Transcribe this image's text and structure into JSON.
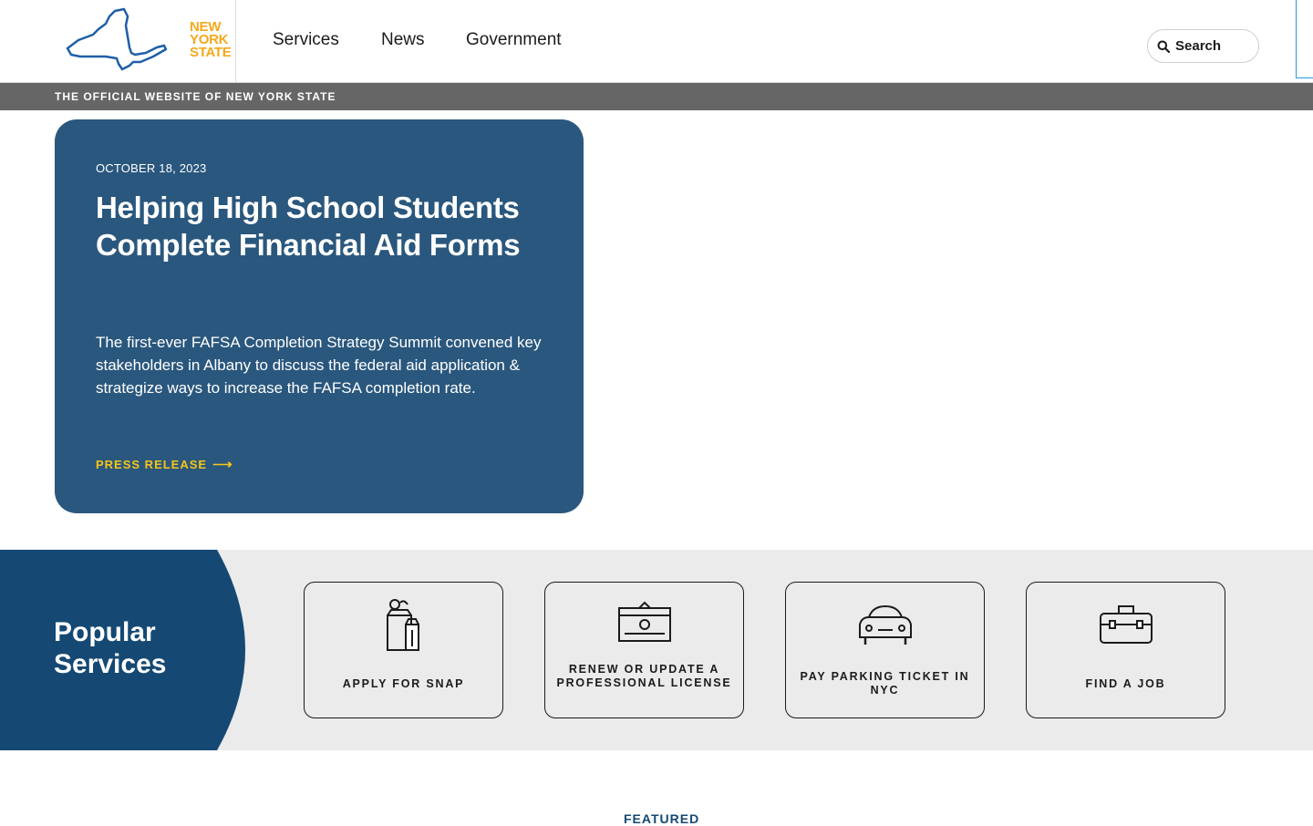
{
  "header": {
    "logo_text": [
      "NEW",
      "YORK",
      "STATE"
    ],
    "nav": {
      "services": "Services",
      "news": "News",
      "government": "Government"
    },
    "search_label": "Search"
  },
  "official_bar": {
    "text": "THE OFFICIAL WEBSITE OF NEW YORK STATE"
  },
  "hero": {
    "date": "OCTOBER 18, 2023",
    "title": "Helping High School Students Complete Financial Aid Forms",
    "body": "The first-ever FAFSA Completion Strategy Summit convened key stakeholders in Albany to discuss the federal aid application & strategize ways to increase the FAFSA completion rate.",
    "link_label": "PRESS RELEASE"
  },
  "popular": {
    "title_line1": "Popular",
    "title_line2": "Services",
    "cards": [
      {
        "label": "APPLY FOR SNAP",
        "icon": "grocery-bag-icon"
      },
      {
        "label": "RENEW OR UPDATE A PROFESSIONAL LICENSE",
        "icon": "certificate-icon"
      },
      {
        "label": "PAY PARKING TICKET IN NYC",
        "icon": "car-icon"
      },
      {
        "label": "FIND A JOB",
        "icon": "briefcase-icon"
      }
    ]
  },
  "featured_label": "FEATURED",
  "colors": {
    "hero_bg": "#2a577d",
    "popular_blob": "#154973",
    "accent_yellow": "#f5c518",
    "logo_orange": "#f5a81c",
    "official_bar": "#666666"
  }
}
